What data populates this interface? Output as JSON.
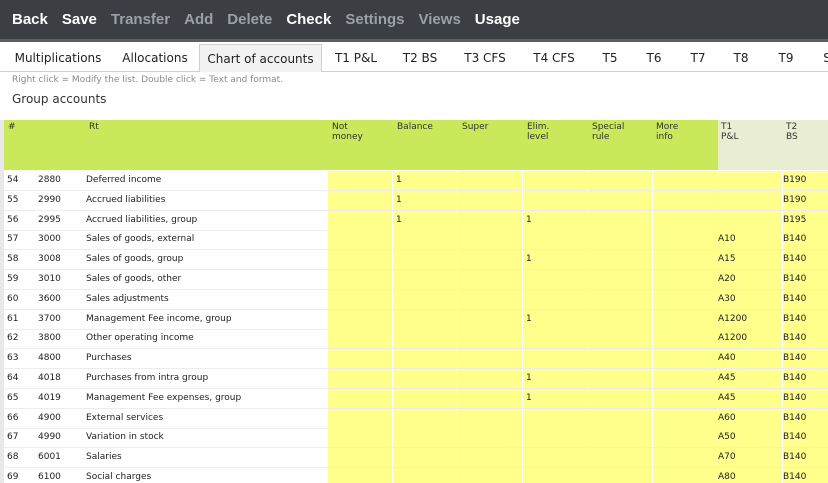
{
  "toolbar": {
    "buttons": [
      {
        "label": "Back",
        "enabled": true
      },
      {
        "label": "Save",
        "enabled": true
      },
      {
        "label": "Transfer",
        "enabled": false
      },
      {
        "label": "Add",
        "enabled": false
      },
      {
        "label": "Delete",
        "enabled": false
      },
      {
        "label": "Check",
        "enabled": true
      },
      {
        "label": "Settings",
        "enabled": false
      },
      {
        "label": "Views",
        "enabled": false
      },
      {
        "label": "Usage",
        "enabled": true
      }
    ]
  },
  "tabs": [
    {
      "label": "Multiplications"
    },
    {
      "label": "Allocations"
    },
    {
      "label": "Chart of accounts",
      "active": true
    },
    {
      "label": "T1 P&L"
    },
    {
      "label": "T2 BS"
    },
    {
      "label": "T3 CFS"
    },
    {
      "label": "T4 CFS"
    },
    {
      "label": "T5"
    },
    {
      "label": "T6"
    },
    {
      "label": "T7"
    },
    {
      "label": "T8"
    },
    {
      "label": "T9"
    },
    {
      "label": "S"
    }
  ],
  "hint": "Right click = Modify the list. Double click = Text and format.",
  "section_title": "Group accounts",
  "columns": [
    "#",
    "Rt",
    "Not\nmoney",
    "Balance",
    "Super",
    "Elim.\nlevel",
    "Special\nrule",
    "More\ninfo",
    "T1\nP&L",
    "T2\nBS"
  ],
  "rows": [
    {
      "idx": "54",
      "acct": "2880",
      "name": "Deferred income",
      "balance": "1",
      "elim": "",
      "t1": "",
      "t2": "B190"
    },
    {
      "idx": "55",
      "acct": "2990",
      "name": "Accrued liabilities",
      "balance": "1",
      "elim": "",
      "t1": "",
      "t2": "B190"
    },
    {
      "idx": "56",
      "acct": "2995",
      "name": "Accrued liabilities, group",
      "balance": "1",
      "elim": "1",
      "t1": "",
      "t2": "B195"
    },
    {
      "idx": "57",
      "acct": "3000",
      "name": "Sales of goods, external",
      "balance": "",
      "elim": "",
      "t1": "A10",
      "t2": "B140"
    },
    {
      "idx": "58",
      "acct": "3008",
      "name": "Sales of goods, group",
      "balance": "",
      "elim": "1",
      "t1": "A15",
      "t2": "B140"
    },
    {
      "idx": "59",
      "acct": "3010",
      "name": "Sales of goods, other",
      "balance": "",
      "elim": "",
      "t1": "A20",
      "t2": "B140"
    },
    {
      "idx": "60",
      "acct": "3600",
      "name": "Sales adjustments",
      "balance": "",
      "elim": "",
      "t1": "A30",
      "t2": "B140"
    },
    {
      "idx": "61",
      "acct": "3700",
      "name": "Management Fee income, group",
      "balance": "",
      "elim": "1",
      "t1": "A1200",
      "t2": "B140"
    },
    {
      "idx": "62",
      "acct": "3800",
      "name": "Other operating income",
      "balance": "",
      "elim": "",
      "t1": "A1200",
      "t2": "B140"
    },
    {
      "idx": "63",
      "acct": "4800",
      "name": "Purchases",
      "balance": "",
      "elim": "",
      "t1": "A40",
      "t2": "B140"
    },
    {
      "idx": "64",
      "acct": "4018",
      "name": "Purchases from intra group",
      "balance": "",
      "elim": "1",
      "t1": "A45",
      "t2": "B140"
    },
    {
      "idx": "65",
      "acct": "4019",
      "name": "Management Fee expenses, group",
      "balance": "",
      "elim": "1",
      "t1": "A45",
      "t2": "B140"
    },
    {
      "idx": "66",
      "acct": "4900",
      "name": "External services",
      "balance": "",
      "elim": "",
      "t1": "A60",
      "t2": "B140"
    },
    {
      "idx": "67",
      "acct": "4990",
      "name": "Variation in stock",
      "balance": "",
      "elim": "",
      "t1": "A50",
      "t2": "B140"
    },
    {
      "idx": "68",
      "acct": "6001",
      "name": "Salaries",
      "balance": "",
      "elim": "",
      "t1": "A70",
      "t2": "B140"
    },
    {
      "idx": "69",
      "acct": "6100",
      "name": "Social charges",
      "balance": "",
      "elim": "",
      "t1": "A80",
      "t2": "B140"
    }
  ],
  "colors": {
    "toolbar_bg": "#3b3f44",
    "header_green": "#c9e85a",
    "cell_yellow": "#ffff8c",
    "t_header": "#e9eed2"
  }
}
